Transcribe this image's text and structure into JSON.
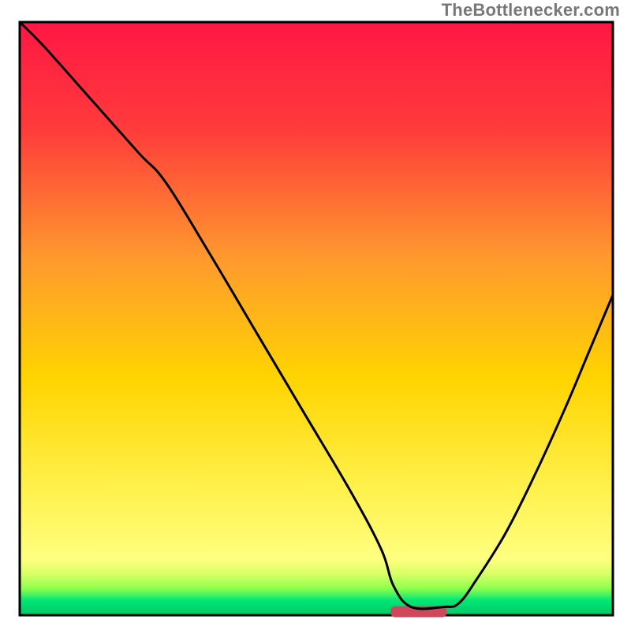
{
  "watermark": "TheBottleneсker.com",
  "chart_data": {
    "type": "line",
    "title": "",
    "xlabel": "",
    "ylabel": "",
    "xlim": [
      0,
      1
    ],
    "ylim": [
      0,
      1
    ],
    "grid": false,
    "axes_visible": false,
    "gradient_stops": [
      {
        "offset": 0.0,
        "color": "#ff1744"
      },
      {
        "offset": 0.18,
        "color": "#ff3b3b"
      },
      {
        "offset": 0.4,
        "color": "#ff9a2e"
      },
      {
        "offset": 0.6,
        "color": "#ffd400"
      },
      {
        "offset": 0.78,
        "color": "#fff04a"
      },
      {
        "offset": 0.905,
        "color": "#ffff80"
      },
      {
        "offset": 0.93,
        "color": "#d8ff66"
      },
      {
        "offset": 0.955,
        "color": "#8eff4d"
      },
      {
        "offset": 0.975,
        "color": "#00e676"
      },
      {
        "offset": 1.0,
        "color": "#00c864"
      }
    ],
    "note": "No axis labels or ticks are visible. x and y are normalized to the plotting square. y is the height of the black curve above the bottom edge (fraction of plot height). Values below are read off the visible curve.",
    "series": [
      {
        "name": "curve",
        "x": [
          0.0,
          0.04,
          0.12,
          0.2,
          0.246,
          0.32,
          0.4,
          0.48,
          0.56,
          0.61,
          0.63,
          0.66,
          0.715,
          0.74,
          0.77,
          0.82,
          0.87,
          0.92,
          0.96,
          1.0
        ],
        "y": [
          1.0,
          0.96,
          0.87,
          0.78,
          0.73,
          0.61,
          0.475,
          0.34,
          0.205,
          0.11,
          0.05,
          0.014,
          0.014,
          0.02,
          0.06,
          0.14,
          0.24,
          0.35,
          0.445,
          0.54
        ]
      }
    ],
    "flat_region": {
      "x_start": 0.63,
      "x_end": 0.715,
      "y": 0.014
    },
    "marker": {
      "shape": "rounded-bar",
      "x_start": 0.625,
      "x_end": 0.72,
      "y": 0.006,
      "color": "#d0465a"
    }
  }
}
